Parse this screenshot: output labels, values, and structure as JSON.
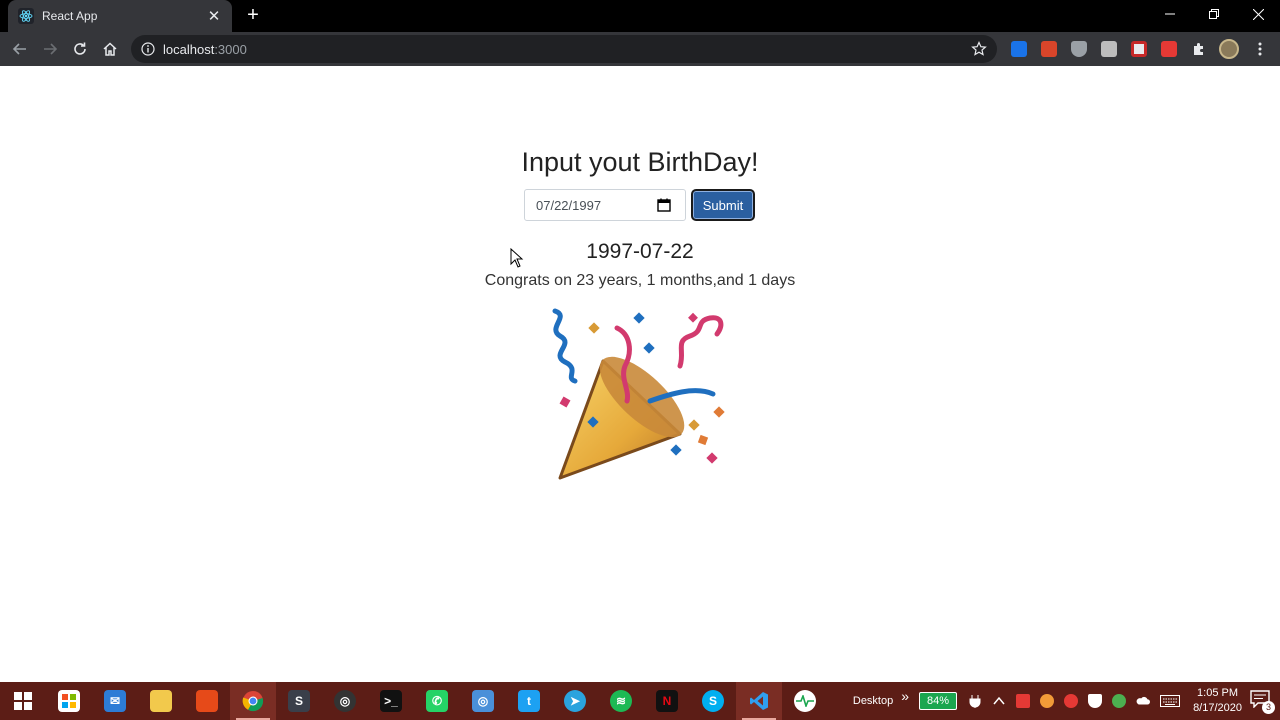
{
  "browser": {
    "tab_title": "React App",
    "url_host": "localhost",
    "url_port": ":3000",
    "new_tab_label": "+",
    "tab_close_label": "✕"
  },
  "app": {
    "heading": "Input yout BirthDay!",
    "date_input_value": "07/22/1997",
    "submit_label": "Submit",
    "result_date": "1997-07-22",
    "congrats_text": "Congrats on 23 years, 1 months,and 1 days"
  },
  "taskbar": {
    "desktop_label": "Desktop",
    "overflow_label": "»",
    "battery_percent": "84%",
    "time": "1:05 PM",
    "date": "8/17/2020",
    "notification_count": "3"
  },
  "colors": {
    "taskbar_bg": "#5c1d16",
    "submit_bg": "#2b5fa0",
    "chrome_dark": "#35363a"
  }
}
